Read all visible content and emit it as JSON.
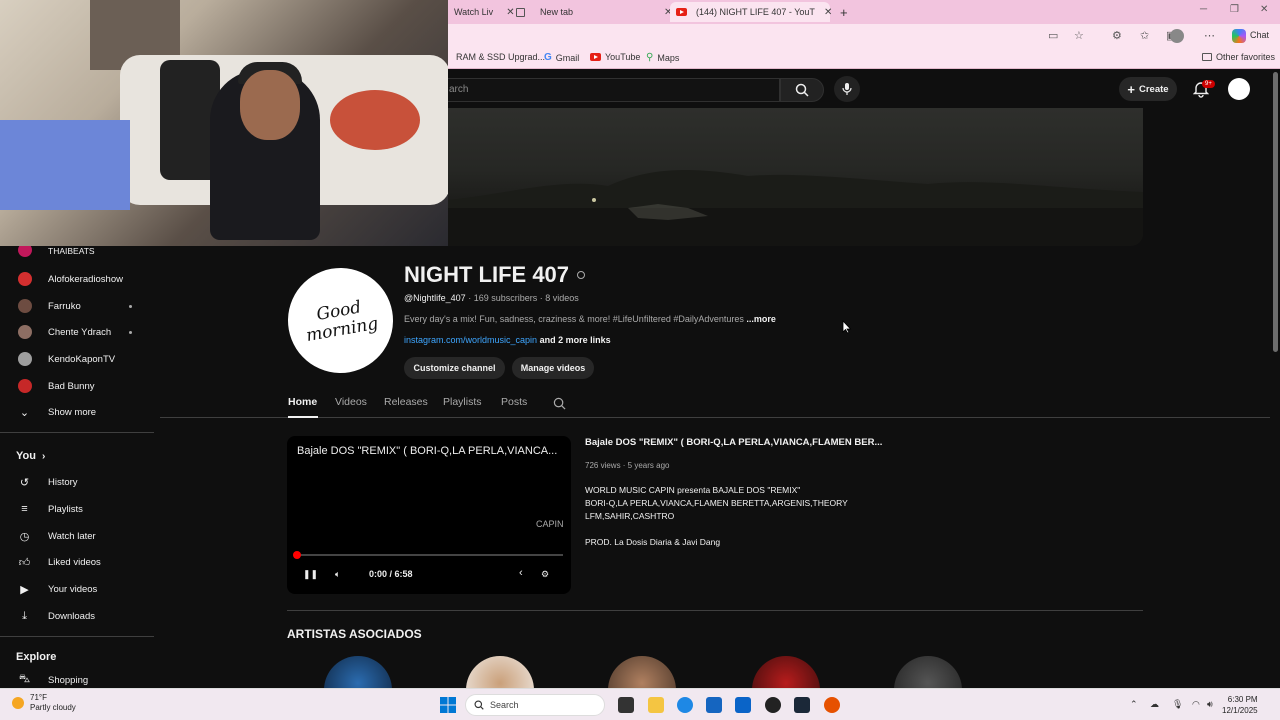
{
  "browser": {
    "tabs": [
      {
        "label": "Watch Liv"
      },
      {
        "label": "New tab"
      },
      {
        "label": "(144) NIGHT LIFE 407 - YouT"
      }
    ],
    "bookmarks": [
      {
        "label": "RAM & SSD Upgrad..."
      },
      {
        "label": "Gmail"
      },
      {
        "label": "YouTube"
      },
      {
        "label": "Maps"
      }
    ],
    "other_favorites": "Other favorites",
    "chat_label": "Chat"
  },
  "youtube": {
    "search_placeholder": "arch",
    "create_label": "Create",
    "notif_badge": "9+"
  },
  "sidebar": {
    "subscriptions": [
      {
        "label": "THAIBEATS",
        "color": "#c2185b"
      },
      {
        "label": "Alofokeradioshow",
        "color": "#d32f2f"
      },
      {
        "label": "Farruko",
        "color": "#6d4c41"
      },
      {
        "label": "Chente Ydrach",
        "color": "#8d6e63"
      },
      {
        "label": "KendoKaponTV",
        "color": "#9e9e9e"
      },
      {
        "label": "Bad Bunny",
        "color": "#c62828"
      }
    ],
    "show_more": "Show more",
    "you_heading": "You",
    "you_items": [
      {
        "label": "History",
        "icon": "history-icon"
      },
      {
        "label": "Playlists",
        "icon": "playlist-icon"
      },
      {
        "label": "Watch later",
        "icon": "clock-icon"
      },
      {
        "label": "Liked videos",
        "icon": "thumbs-up-icon"
      },
      {
        "label": "Your videos",
        "icon": "video-icon"
      },
      {
        "label": "Downloads",
        "icon": "download-icon"
      }
    ],
    "explore_heading": "Explore",
    "explore_items": [
      {
        "label": "Shopping",
        "icon": "bag-icon"
      }
    ]
  },
  "channel": {
    "avatar_text": "Good morning",
    "name": "NIGHT LIFE 407",
    "handle": "@Nightlife_407",
    "stats": "· 169 subscribers · 8 videos",
    "description": "Every day's a mix! Fun, sadness, craziness & more! #LifeUnfiltered #DailyAdventures",
    "more": "...more",
    "link": "instagram.com/worldmusic_capin",
    "more_links": "and 2 more links",
    "customize_label": "Customize channel",
    "manage_label": "Manage videos",
    "tabs": [
      "Home",
      "Videos",
      "Releases",
      "Playlists",
      "Posts"
    ]
  },
  "featured": {
    "player_title": "Bajale DOS \"REMIX\" ( BORI-Q,LA PERLA,VIANCA...",
    "logo_text": "CAPIN",
    "time": "0:00 / 6:58",
    "title": "Bajale DOS \"REMIX\" ( BORI-Q,LA PERLA,VIANCA,FLAMEN BER...",
    "meta": "726 views · 5 years ago",
    "desc_lines": [
      "WORLD MUSIC CAPIN presenta BAJALE DOS \"REMIX\"",
      "BORI-Q,LA PERLA,VIANCA,FLAMEN BERETTA,ARGENIS,THEORY",
      "LFM,SAHIR,CASHTRO"
    ],
    "prod": "PROD. La Dosis Diaria & Javi Dang",
    "progress": 0
  },
  "section_title": "ARTISTAS ASOCIADOS",
  "taskbar": {
    "temp": "71°F",
    "condition": "Partly cloudy",
    "search": "Search",
    "time": "6:30 PM",
    "date": "12/1/2025"
  }
}
